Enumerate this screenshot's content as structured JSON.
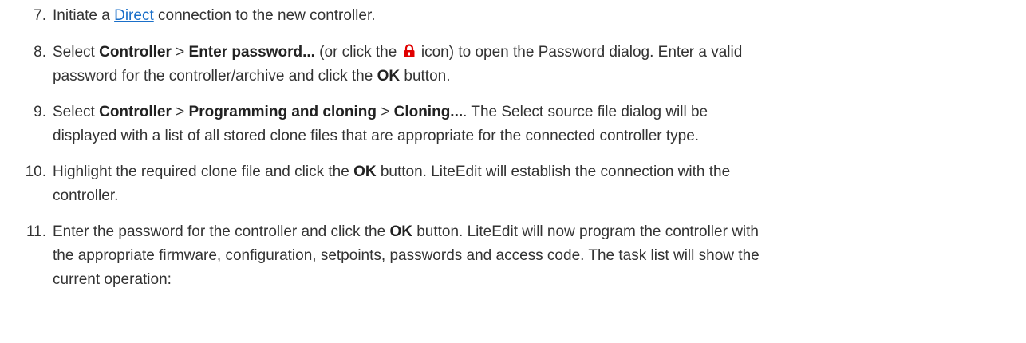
{
  "steps": [
    {
      "number": "7.",
      "parts": {
        "a": "Initiate a ",
        "link": "Direct",
        "b": " connection to the new controller."
      }
    },
    {
      "number": "8.",
      "parts": {
        "a": "Select ",
        "b1": "Controller",
        "c": " > ",
        "b2": "Enter password...",
        "d": " (or click the ",
        "e": " icon) to open the Password dialog. Enter a valid",
        "line2a": "password for the controller/archive and click the ",
        "b3": "OK",
        "line2b": " button."
      }
    },
    {
      "number": "9.",
      "parts": {
        "a": "Select ",
        "b1": "Controller",
        "c": " > ",
        "b2": "Programming and cloning",
        "d": " > ",
        "b3": "Cloning...",
        "e": ". The Select source file dialog will be",
        "line2": "displayed with a list of all stored clone files that are appropriate for the connected controller type."
      }
    },
    {
      "number": "10.",
      "parts": {
        "a": "Highlight the required clone file and click the ",
        "b1": "OK",
        "c": " button. LiteEdit will establish the connection with the",
        "line2": "controller."
      }
    },
    {
      "number": "11.",
      "parts": {
        "a": "Enter the password for the controller and click the ",
        "b1": "OK",
        "c": " button. LiteEdit will now program the controller with",
        "line2": "the appropriate firmware, configuration, setpoints, passwords and access code. The task list will show the",
        "line3": "current operation:"
      }
    }
  ],
  "icons": {
    "lock": "lock-icon",
    "lock_color": "#e00000"
  },
  "colors": {
    "text": "#333333",
    "link": "#1a6fc9"
  }
}
